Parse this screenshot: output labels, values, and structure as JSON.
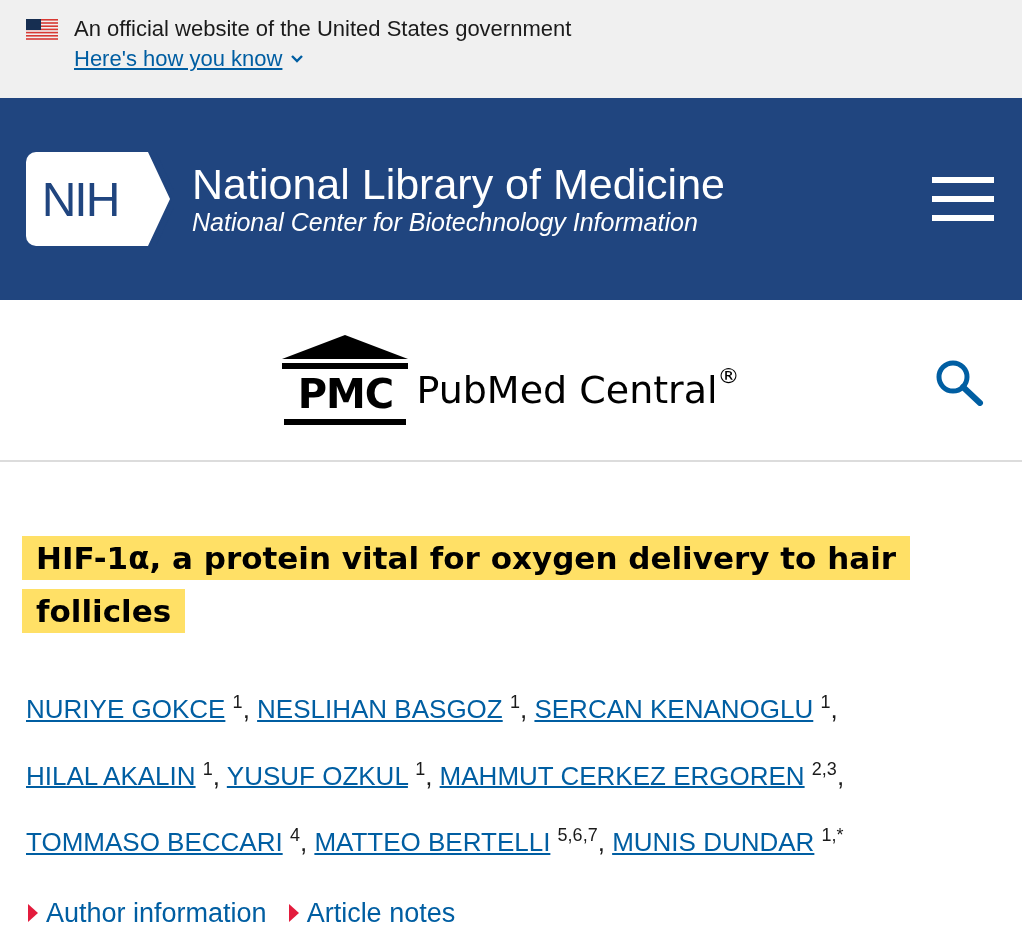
{
  "gov_banner": {
    "text": "An official website of the United States government",
    "link": "Here's how you know"
  },
  "header": {
    "logo_text": "NIH",
    "title": "National Library of Medicine",
    "subtitle": "National Center for Biotechnology Information"
  },
  "pmc_bar": {
    "logo_text": "PMC",
    "name": "PubMed Central",
    "mark": "®"
  },
  "article": {
    "title": "HIF-1α, a protein vital for oxygen delivery to hair follicles",
    "authors": [
      {
        "name": "NURIYE GOKCE",
        "affiliations": "1",
        "separator": ","
      },
      {
        "name": "NESLIHAN BASGOZ",
        "affiliations": "1",
        "separator": ","
      },
      {
        "name": "SERCAN KENANOGLU",
        "affiliations": "1",
        "separator": ","
      },
      {
        "name": "HILAL AKALIN",
        "affiliations": "1",
        "separator": ","
      },
      {
        "name": "YUSUF OZKUL",
        "affiliations": "1",
        "separator": ","
      },
      {
        "name": "MAHMUT CERKEZ ERGOREN",
        "affiliations": "2,3",
        "separator": ","
      },
      {
        "name": "TOMMASO BECCARI",
        "affiliations": "4",
        "separator": ","
      },
      {
        "name": "MATTEO BERTELLI",
        "affiliations": "5,6,7",
        "separator": ","
      },
      {
        "name": "MUNIS DUNDAR",
        "affiliations": "1,*"
      }
    ],
    "sections": [
      {
        "label": "Author information",
        "expanded": false
      },
      {
        "label": "Article notes",
        "expanded": false
      }
    ]
  }
}
